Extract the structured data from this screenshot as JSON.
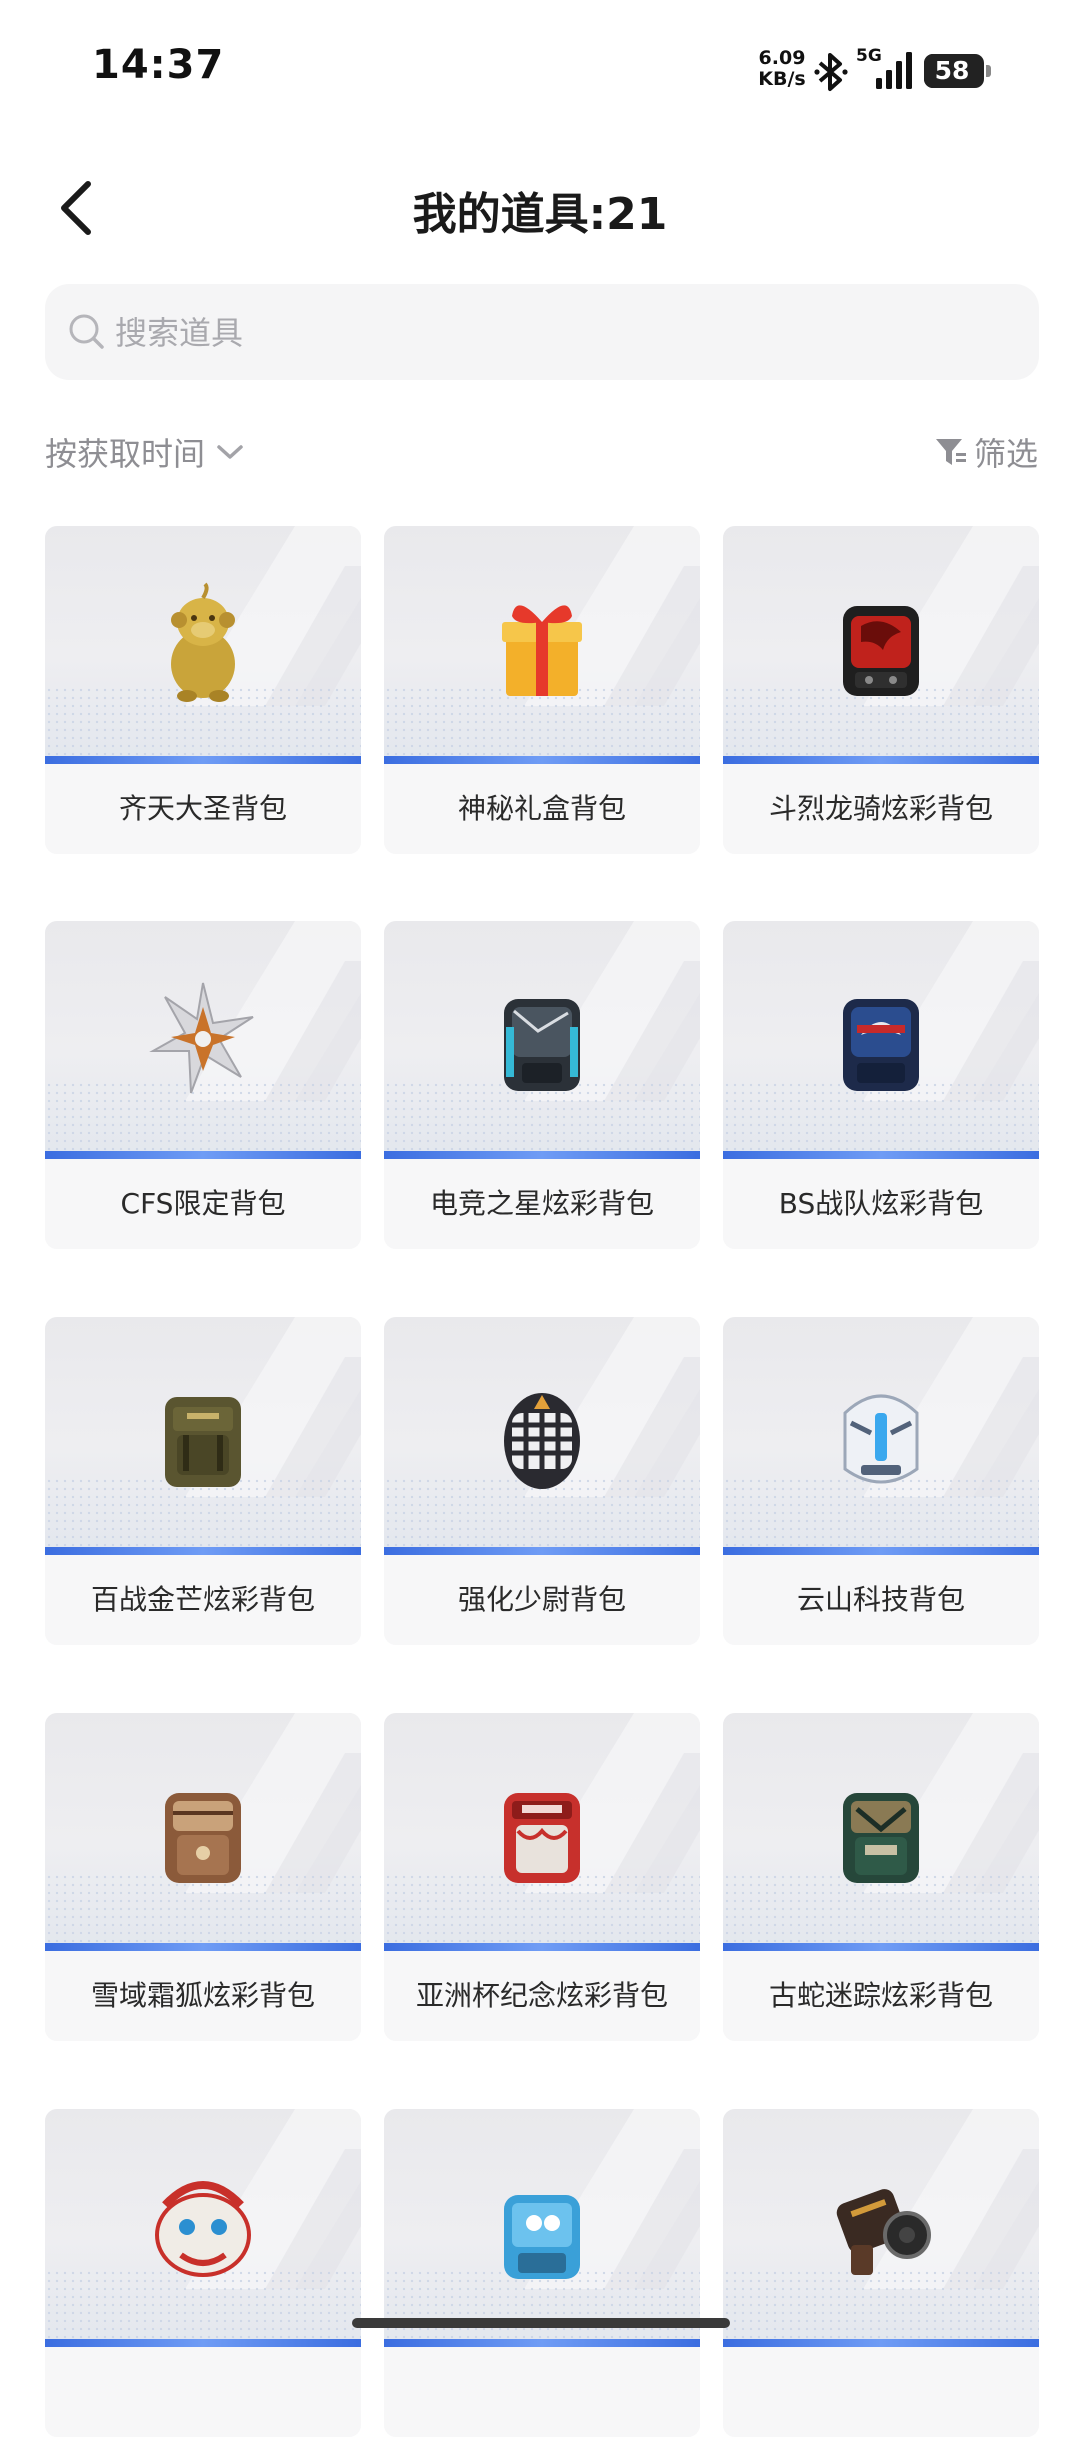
{
  "status_bar": {
    "time": "14:37",
    "net_speed_value": "6.09",
    "net_speed_unit": "KB/s",
    "network_type": "5G",
    "battery": "58"
  },
  "header": {
    "title": "我的道具:21"
  },
  "search": {
    "placeholder": "搜索道具"
  },
  "toolbar": {
    "sort_label": "按获取时间",
    "filter_label": "筛选"
  },
  "items": [
    {
      "name": "齐天大圣背包",
      "icon": "golden-monkey-icon"
    },
    {
      "name": "神秘礼盒背包",
      "icon": "gift-box-icon"
    },
    {
      "name": "斗烈龙骑炫彩背包",
      "icon": "red-dragon-backpack-icon"
    },
    {
      "name": "CFS限定背包",
      "icon": "silver-star-icon"
    },
    {
      "name": "电竞之星炫彩背包",
      "icon": "esports-backpack-icon"
    },
    {
      "name": "BS战队炫彩背包",
      "icon": "team-backpack-icon"
    },
    {
      "name": "百战金芒炫彩背包",
      "icon": "olive-backpack-icon"
    },
    {
      "name": "强化少尉背包",
      "icon": "plaid-backpack-icon"
    },
    {
      "name": "云山科技背包",
      "icon": "tech-helmet-backpack-icon"
    },
    {
      "name": "雪域霜狐炫彩背包",
      "icon": "brown-backpack-icon"
    },
    {
      "name": "亚洲杯纪念炫彩背包",
      "icon": "asian-cup-backpack-icon"
    },
    {
      "name": "古蛇迷踪炫彩背包",
      "icon": "green-snake-backpack-icon"
    },
    {
      "name": "",
      "icon": "lion-dance-icon"
    },
    {
      "name": "",
      "icon": "blue-graffiti-backpack-icon"
    },
    {
      "name": "",
      "icon": "cannon-icon"
    }
  ]
}
